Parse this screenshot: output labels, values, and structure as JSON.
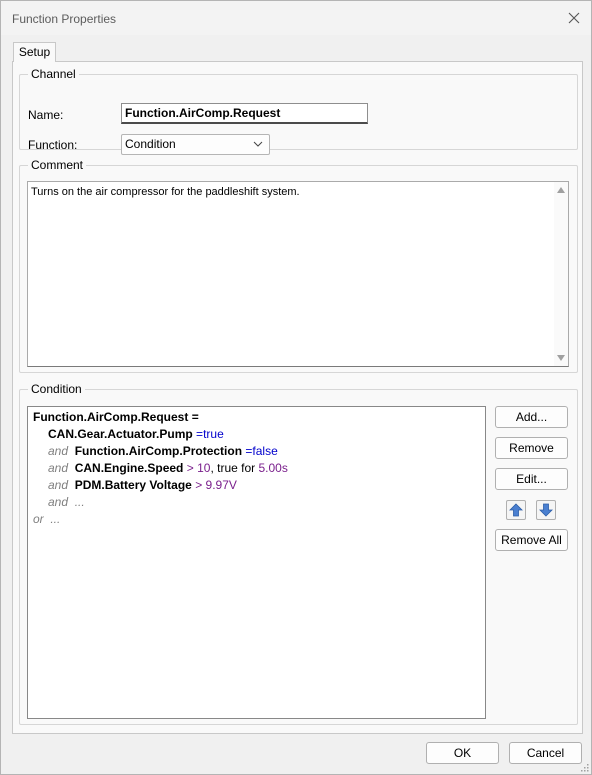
{
  "window": {
    "title": "Function Properties"
  },
  "tabs": [
    {
      "label": "Setup"
    }
  ],
  "channel": {
    "group_label": "Channel",
    "name_label": "Name:",
    "name_value": "Function.AirComp.Request",
    "function_label": "Function:",
    "function_value": "Condition"
  },
  "comment": {
    "group_label": "Comment",
    "text": "Turns on the air compressor for the paddleshift system."
  },
  "condition": {
    "group_label": "Condition",
    "target": "Function.AirComp.Request",
    "equals": "=",
    "lines": [
      {
        "channel": "CAN.Gear.Actuator.Pump",
        "op": "=",
        "value": "true"
      },
      {
        "kw": "and",
        "channel": "Function.AirComp.Protection",
        "op": "=",
        "value": "false"
      },
      {
        "kw": "and",
        "channel": "CAN.Engine.Speed",
        "op": ">",
        "value": "10",
        "extra": ", true for",
        "duration": "5.00s"
      },
      {
        "kw": "and",
        "channel": "PDM.Battery Voltage",
        "op": ">",
        "value": "9.97V"
      },
      {
        "kw": "and",
        "placeholder": "..."
      },
      {
        "kw": "or",
        "placeholder": "..."
      }
    ],
    "buttons": {
      "add": "Add...",
      "remove": "Remove",
      "edit": "Edit...",
      "remove_all": "Remove All"
    }
  },
  "footer": {
    "ok": "OK",
    "cancel": "Cancel"
  },
  "icons": {
    "close": "close-icon",
    "dropdown": "chevron-down-icon",
    "move_up": "arrow-up-icon",
    "move_down": "arrow-down-icon"
  },
  "colors": {
    "value_blue": "#0000cc",
    "value_purple": "#7a1f8c",
    "accent": "#4a7fd0"
  }
}
